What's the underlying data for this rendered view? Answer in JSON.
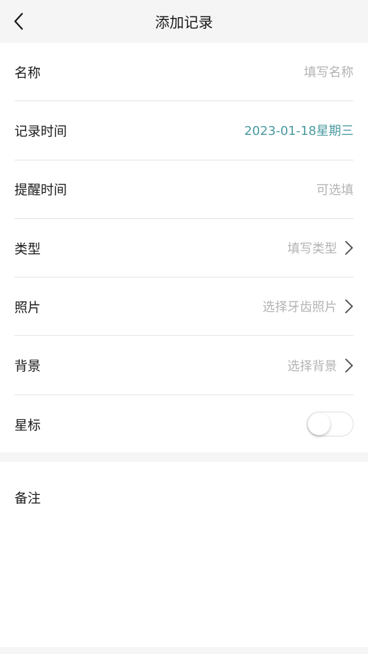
{
  "nav": {
    "title": "添加记录",
    "back_icon": "chevron-left-icon"
  },
  "form": {
    "name": {
      "label": "名称",
      "placeholder": "填写名称"
    },
    "record_time": {
      "label": "记录时间",
      "value": "2023-01-18星期三"
    },
    "reminder_time": {
      "label": "提醒时间",
      "placeholder": "可选填"
    },
    "type": {
      "label": "类型",
      "placeholder": "填写类型"
    },
    "photo": {
      "label": "照片",
      "placeholder": "选择牙齿照片"
    },
    "background": {
      "label": "背景",
      "placeholder": "选择背景"
    },
    "star": {
      "label": "星标",
      "enabled": false
    }
  },
  "notes": {
    "label": "备注"
  },
  "colors": {
    "accent": "#4a9aa0",
    "placeholder": "#b3b3b3",
    "text": "#1a1a1a",
    "page_bg": "#f5f5f5"
  }
}
